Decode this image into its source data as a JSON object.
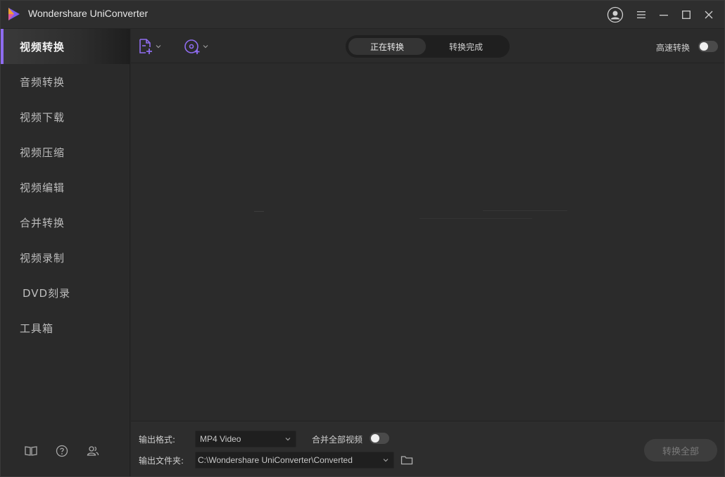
{
  "app": {
    "title": "Wondershare UniConverter"
  },
  "sidebar": {
    "items": [
      {
        "label": "视频转换",
        "active": true
      },
      {
        "label": "音频转换"
      },
      {
        "label": "视频下载"
      },
      {
        "label": "视频压缩"
      },
      {
        "label": "视频编辑"
      },
      {
        "label": "合并转换"
      },
      {
        "label": "视频录制"
      },
      {
        "label": "DVD刻录"
      },
      {
        "label": "工具箱"
      }
    ],
    "footer_icons": [
      "book-icon",
      "help-icon",
      "users-icon"
    ]
  },
  "toolbar": {
    "tabs": [
      {
        "label": "正在转换",
        "active": true
      },
      {
        "label": "转换完成"
      }
    ],
    "high_speed_label": "高速转换",
    "high_speed_enabled": false
  },
  "bottom": {
    "output_format_label": "输出格式:",
    "output_format_value": "MP4 Video",
    "merge_label": "合并全部视频",
    "merge_enabled": false,
    "output_folder_label": "输出文件夹:",
    "output_folder_value": "C:\\Wondershare UniConverter\\Converted",
    "convert_all_label": "转换全部"
  },
  "colors": {
    "accent": "#8f6cf0",
    "background": "#2b2b2b",
    "sidebar": "#2a2a2a"
  }
}
